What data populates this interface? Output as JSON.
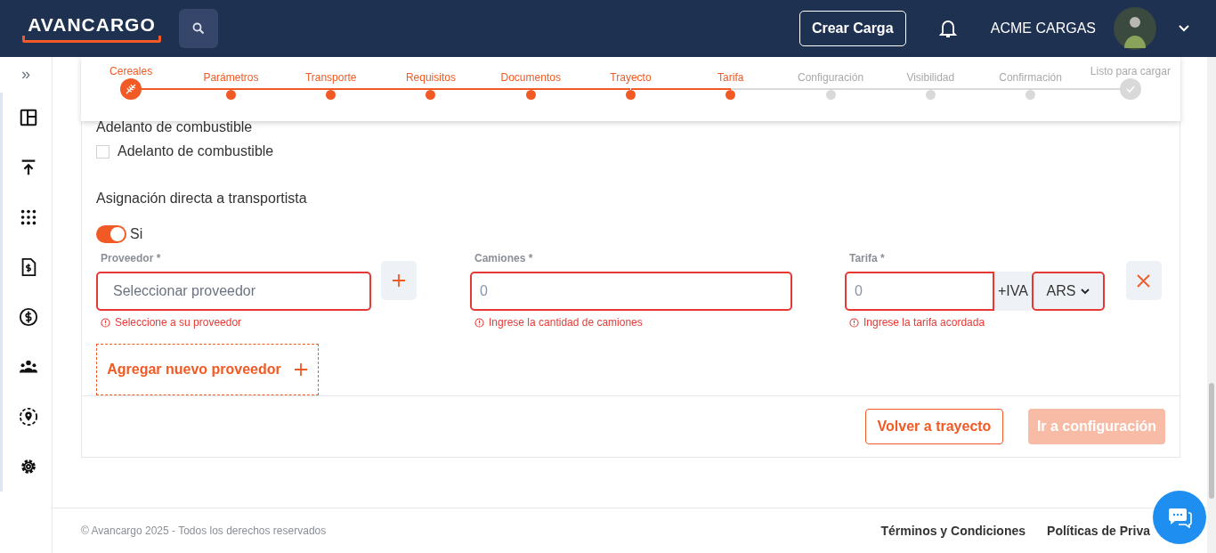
{
  "header": {
    "logo": "AVANCARGO",
    "create_button": "Crear Carga",
    "company": "ACME CARGAS"
  },
  "sidebar": {
    "expand_glyph": "»",
    "items": [
      {
        "selected": false
      },
      {
        "selected": false
      },
      {
        "selected": false
      },
      {
        "selected": false
      },
      {
        "selected": false
      },
      {
        "selected": false
      },
      {
        "selected": false
      },
      {
        "selected": false
      }
    ]
  },
  "stepper": [
    {
      "label": "Cereales",
      "kind": "wheat",
      "complete": true
    },
    {
      "label": "Parámetros",
      "kind": "dot",
      "complete": true
    },
    {
      "label": "Transporte",
      "kind": "dot",
      "complete": true
    },
    {
      "label": "Requisitos",
      "kind": "dot",
      "complete": true
    },
    {
      "label": "Documentos",
      "kind": "dot",
      "complete": true
    },
    {
      "label": "Trayecto",
      "kind": "dot",
      "complete": true
    },
    {
      "label": "Tarifa",
      "kind": "dot",
      "complete": true
    },
    {
      "label": "Configuración",
      "kind": "dot",
      "complete": false
    },
    {
      "label": "Visibilidad",
      "kind": "dot",
      "complete": false
    },
    {
      "label": "Confirmación",
      "kind": "dot",
      "complete": false
    },
    {
      "label": "Listo para cargar",
      "kind": "check",
      "complete": false
    }
  ],
  "form": {
    "fuel_section": {
      "title": "Adelanto de combustible",
      "checkbox": {
        "label": "Adelanto de combustible",
        "checked": false
      }
    },
    "assignment": {
      "title": "Asignación directa a transportista",
      "toggle": {
        "label": "Si",
        "on": true
      }
    },
    "provider": {
      "label": "Proveedor *",
      "placeholder": "Seleccionar proveedor",
      "error": "Seleccione a su proveedor"
    },
    "trucks": {
      "label": "Camiones *",
      "placeholder": "0",
      "error": "Ingrese la cantidad de camiones"
    },
    "rate": {
      "label": "Tarifa *",
      "placeholder": "0",
      "suffix": "+IVA",
      "currency": "ARS",
      "error": "Ingrese la tarifa acordada"
    },
    "add_provider": "Agregar nuevo proveedor",
    "back_button": "Volver a trayecto",
    "next_button": {
      "label": "Ir a configuración",
      "disabled": true
    }
  },
  "footer": {
    "copyright": "© Avancargo 2025 - Todos los derechos reservados",
    "links": [
      "Términos y Condiciones",
      "Políticas de Priva"
    ]
  }
}
